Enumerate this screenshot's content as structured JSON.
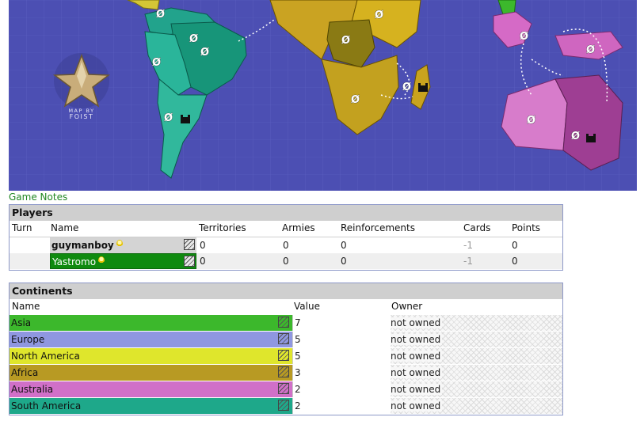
{
  "map": {
    "badge_text": "MAP BY",
    "badge_name": "FOIST",
    "army_symbol": "Ø",
    "fort_icon": "castle-icon"
  },
  "links": {
    "game_notes": "Game Notes"
  },
  "players": {
    "title": "Players",
    "headers": {
      "turn": "Turn",
      "name": "Name",
      "territories": "Territories",
      "armies": "Armies",
      "reinforcements": "Reinforcements",
      "cards": "Cards",
      "points": "Points"
    },
    "rows": [
      {
        "name": "guymanboy",
        "territories": "0",
        "armies": "0",
        "reinforcements": "0",
        "cards": "-1",
        "points": "0"
      },
      {
        "name": "Yastromo",
        "territories": "0",
        "armies": "0",
        "reinforcements": "0",
        "cards": "-1",
        "points": "0"
      }
    ]
  },
  "continents": {
    "title": "Continents",
    "headers": {
      "name": "Name",
      "value": "Value",
      "owner": "Owner"
    },
    "rows": [
      {
        "name": "Asia",
        "value": "7",
        "owner": "not owned",
        "color": "#3cb82c"
      },
      {
        "name": "Europe",
        "value": "5",
        "owner": "not owned",
        "color": "#8f97e0"
      },
      {
        "name": "North America",
        "value": "5",
        "owner": "not owned",
        "color": "#dfe62c"
      },
      {
        "name": "Africa",
        "value": "3",
        "owner": "not owned",
        "color": "#b89a23"
      },
      {
        "name": "Australia",
        "value": "2",
        "owner": "not owned",
        "color": "#d070c8"
      },
      {
        "name": "South America",
        "value": "2",
        "owner": "not owned",
        "color": "#1ea88a"
      }
    ]
  },
  "colors": {
    "panel_border": "#8d98c8",
    "title_bg": "#cfcfcf",
    "link": "#228822",
    "player2": "#0f8a0f"
  }
}
